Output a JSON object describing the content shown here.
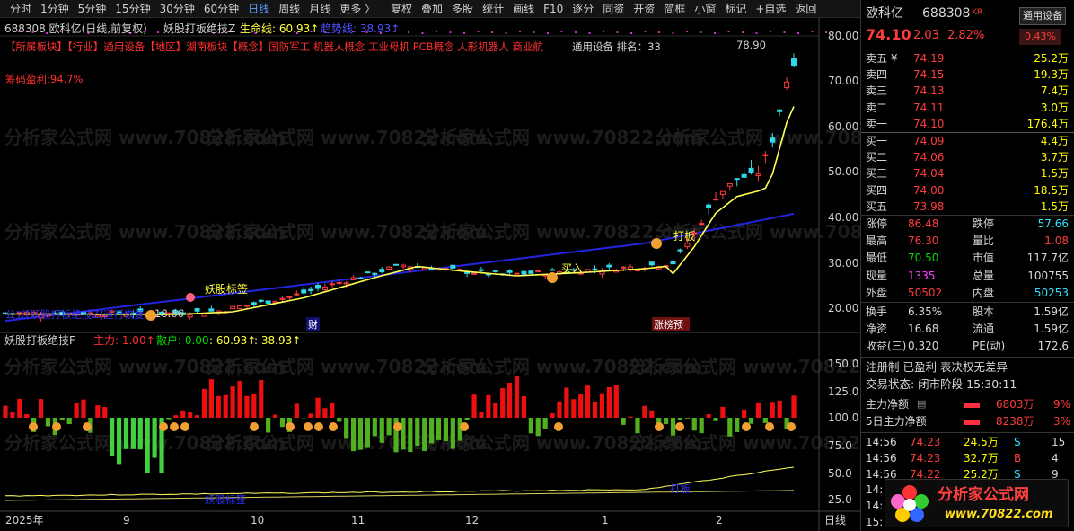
{
  "toolbar": {
    "periods": [
      "分时",
      "1分钟",
      "5分钟",
      "15分钟",
      "30分钟",
      "60分钟",
      "日线",
      "周线",
      "月线",
      "更多 〉"
    ],
    "active_period": "日线",
    "tools": [
      "复权",
      "叠加",
      "多股",
      "统计",
      "画线",
      "F10",
      "逐分",
      "同资",
      "开资",
      "简框",
      "小窗",
      "标记",
      "+自选",
      "返回"
    ]
  },
  "main_panel": {
    "title": "688308 欧科亿(日线,前复权)",
    "indicator": "妖股打板绝技Z",
    "life_label": "生命线: 60.93↑",
    "trend_label": "趋势线: 38.93↑",
    "concept_tags": "【所属板块】【行业】通用设备【地区】湖南板块【概念】国防军工 机器人概念 工业母机 PCB概念 人形机器人 商业航",
    "rank_text": "通用设备 排名：33",
    "profit_ratio": "筹码盈利:94.7%",
    "price_high_marker": "78.90",
    "price_low_marker": "18.66",
    "annotation_board": "打板",
    "annotation_demon": "妖股标签",
    "annotation_buy": "买入",
    "annotation_run": "公式[妖股打板绝技Z]运行恢复",
    "badge_fin": "财",
    "badge_limit": "涨榜预",
    "axis_ticks": [
      "80.00",
      "70.00",
      "60.00",
      "50.00",
      "40.00",
      "30.00",
      "20.00"
    ]
  },
  "sub_panel": {
    "title": "妖股打板绝技F",
    "main_force": "主力: 1.00↑",
    "retail": "散户: 0.00",
    "val1": ": 60.93↑",
    "val2": ": 38.93↑",
    "axis_ticks": [
      "150.0",
      "125.0",
      "100.0",
      "75.0",
      "50.0",
      "25.0"
    ],
    "annotation_demon": "妖股标签",
    "annotation_board": "打板"
  },
  "x_axis": {
    "labels": [
      "2025年",
      "9",
      "10",
      "11",
      "12",
      "1",
      "2"
    ],
    "period": "日线"
  },
  "quote": {
    "name": "欧科亿",
    "flag": "i",
    "code": "688308",
    "kr": "KR",
    "sector_btn": "通用设备",
    "price": "74.10",
    "change": "2.03",
    "pct": "2.82%",
    "sector_pct": "0.43%"
  },
  "asks": [
    {
      "label": "卖五 ¥",
      "price": "74.19",
      "vol": "25.2万"
    },
    {
      "label": "卖四",
      "price": "74.15",
      "vol": "19.3万"
    },
    {
      "label": "卖三",
      "price": "74.13",
      "vol": "7.4万"
    },
    {
      "label": "卖二",
      "price": "74.11",
      "vol": "3.0万"
    },
    {
      "label": "卖一",
      "price": "74.10",
      "vol": "176.4万"
    }
  ],
  "bids": [
    {
      "label": "买一",
      "price": "74.09",
      "vol": "4.4万"
    },
    {
      "label": "买二",
      "price": "74.06",
      "vol": "3.7万"
    },
    {
      "label": "买三",
      "price": "74.04",
      "vol": "1.5万"
    },
    {
      "label": "买四",
      "price": "74.00",
      "vol": "18.5万"
    },
    {
      "label": "买五",
      "price": "73.98",
      "vol": "1.5万"
    }
  ],
  "stats": [
    {
      "k": "涨停",
      "v": "86.48",
      "k2": "跌停",
      "v2": "57.66"
    },
    {
      "k": "最高",
      "v": "76.30",
      "k2": "量比",
      "v2": "1.08"
    },
    {
      "k": "最低",
      "v": "70.50",
      "k2": "市值",
      "v2": "117.7亿"
    },
    {
      "k": "现量",
      "v": "1335",
      "k2": "总量",
      "v2": "100755"
    },
    {
      "k": "外盘",
      "v": "50502",
      "k2": "内盘",
      "v2": "50253"
    }
  ],
  "stats2": [
    {
      "k": "换手",
      "v": "6.35%",
      "k2": "股本",
      "v2": "1.59亿"
    },
    {
      "k": "净资",
      "v": "16.68",
      "k2": "流通",
      "v2": "1.59亿"
    },
    {
      "k": "收益(三)",
      "v": "0.320",
      "k2": "PE(动)",
      "v2": "172.6"
    }
  ],
  "reg_info": "注册制 已盈利 表决权无差异",
  "trade_status": "交易状态: 闭市阶段 15:30:11",
  "main_flow": {
    "label": "主力净额",
    "icon": "▤",
    "value": "6803万",
    "pct": "9%"
  },
  "flow5": {
    "label": "5日主力净额",
    "value": "8238万",
    "pct": "3%"
  },
  "ticks": [
    {
      "t": "14:56",
      "p": "74.23",
      "v": "24.5万",
      "s": "S",
      "n": "15"
    },
    {
      "t": "14:56",
      "p": "74.23",
      "v": "32.7万",
      "s": "B",
      "n": "4"
    },
    {
      "t": "14:56",
      "p": "74.22",
      "v": "25.2万",
      "s": "S",
      "n": "9"
    },
    {
      "t": "14:",
      "p": "",
      "v": "",
      "s": "",
      "n": ""
    },
    {
      "t": "14:",
      "p": "",
      "v": "",
      "s": "",
      "n": ""
    },
    {
      "t": "15:",
      "p": "",
      "v": "",
      "s": "",
      "n": ""
    }
  ],
  "watermark": {
    "site": "分析家公式网",
    "url": "www.70822.com",
    "bg_text": "分析家公式网 www.70822.com"
  },
  "colors": {
    "up": "#ff3c3c",
    "down": "#00d800",
    "life": "#ffff40",
    "trend": "#2020e0",
    "bg": "#000000"
  }
}
